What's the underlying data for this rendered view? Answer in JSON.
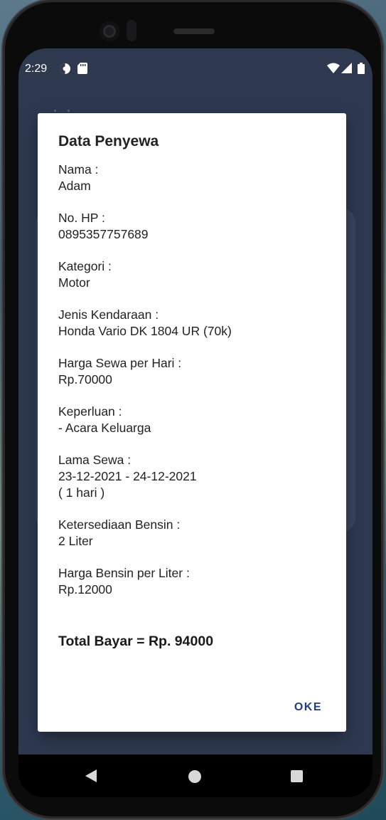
{
  "status_bar": {
    "time": "2:29",
    "icons": [
      "data-saver-icon",
      "sd-card-icon",
      "wifi-icon",
      "signal-icon",
      "battery-icon"
    ]
  },
  "dialog": {
    "title": "Data Penyewa",
    "fields": [
      {
        "label": "Nama :",
        "value": "Adam"
      },
      {
        "label": "No. HP :",
        "value": "0895357757689"
      },
      {
        "label": "Kategori :",
        "value": "Motor"
      },
      {
        "label": "Jenis Kendaraan :",
        "value": "Honda Vario DK 1804 UR (70k)"
      },
      {
        "label": "Harga Sewa per Hari :",
        "value": "Rp.70000"
      },
      {
        "label": "Keperluan :",
        "value": "- Acara Keluarga"
      },
      {
        "label": "Lama Sewa :",
        "value": "23-12-2021 - 24-12-2021",
        "extra": "( 1 hari )"
      },
      {
        "label": "Ketersediaan Bensin :",
        "value": "2 Liter"
      },
      {
        "label": "Harga Bensin per Liter :",
        "value": "Rp.12000"
      }
    ],
    "total": "Total Bayar = Rp. 94000",
    "ok_label": "OKE"
  },
  "colors": {
    "accent": "#1e3a8a",
    "screen_background": "#2e3950",
    "dialog_background": "#ffffff"
  }
}
